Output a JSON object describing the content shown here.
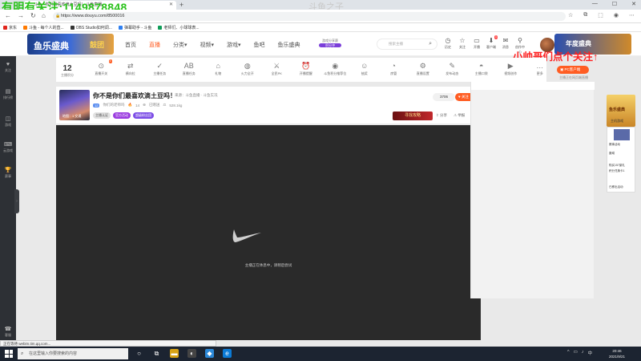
{
  "overlay": {
    "watermark_top": "有明有关注:1149878848",
    "watermark_center": "斗鱼之子",
    "caption_right": "小帅哥们点个关注↑"
  },
  "browser": {
    "tab_title": "斗鱼 - 你们最喜欢滴土豆吗! - 斗鱼直播",
    "new_tab": "+",
    "url": "https://www.douyu.com/8500016",
    "window_buttons": [
      "—",
      "☐",
      "✕"
    ],
    "bookmarks": [
      {
        "label": "京东",
        "color": "#e1251b"
      },
      {
        "label": "斗鱼 - 每个人的直...",
        "color": "#ff7a00"
      },
      {
        "label": "OBS Studio如何调...",
        "color": "#333333"
      },
      {
        "label": "弹幕助手 - 斗鱼",
        "color": "#2e7ff1"
      },
      {
        "label": "老师们、小球球表...",
        "color": "#0f9d58"
      }
    ]
  },
  "site": {
    "logo_text": "鱼乐盛典",
    "logo_badge": "鼓团",
    "nav": [
      "首页",
      "直播",
      "分类",
      "视频",
      "游戏",
      "鱼吧",
      "鱼乐盛典"
    ],
    "promo_line1": "游戏分享赛",
    "promo_line2": "积分冲",
    "search_placeholder": "搜索主播",
    "header_icons": [
      {
        "label": "历史",
        "glyph": "◷",
        "badge": ""
      },
      {
        "label": "关注",
        "glyph": "☆",
        "badge": ""
      },
      {
        "label": "开播",
        "glyph": "▭",
        "badge": ""
      },
      {
        "label": "客户端",
        "glyph": "⬇",
        "badge": "1"
      },
      {
        "label": "消息",
        "glyph": "✉",
        "badge": ""
      },
      {
        "label": "创作中心",
        "glyph": "⚲",
        "badge": ""
      }
    ],
    "header_banner": "年度盛典"
  },
  "sidebar": {
    "items": [
      {
        "label": "关注",
        "glyph": "♥"
      },
      {
        "label": "排行榜",
        "glyph": "▤"
      },
      {
        "label": "游戏",
        "glyph": "◫"
      },
      {
        "label": "云游戏",
        "glyph": "⌨"
      },
      {
        "label": "赛事",
        "glyph": "🏆"
      },
      {
        "label": "客服",
        "glyph": "☎"
      }
    ],
    "collapse": "›"
  },
  "toolbar": {
    "level_num": "12",
    "level_label": "主播积分",
    "items": [
      {
        "label": "直播开关",
        "glyph": "⊙",
        "badge": "3"
      },
      {
        "label": "横向拉",
        "glyph": "⇄",
        "badge": ""
      },
      {
        "label": "主播任务",
        "glyph": "✓",
        "badge": ""
      },
      {
        "label": "直播任务",
        "glyph": "AB",
        "badge": ""
      },
      {
        "label": "礼物",
        "glyph": "⌂",
        "badge": ""
      },
      {
        "label": "火力全开",
        "glyph": "◍",
        "badge": ""
      },
      {
        "label": "全民PK",
        "glyph": "⚔",
        "badge": ""
      },
      {
        "label": "开播提醒",
        "glyph": "⏰",
        "badge": ""
      },
      {
        "label": "斗鱼积分推荐位",
        "glyph": "◉",
        "badge": ""
      },
      {
        "label": "抽奖",
        "glyph": "☺",
        "badge": ""
      },
      {
        "label": "房管",
        "glyph": "◔",
        "badge": ""
      },
      {
        "label": "直播设置",
        "glyph": "⚙",
        "badge": ""
      },
      {
        "label": "发布动态",
        "glyph": "✎",
        "badge": ""
      },
      {
        "label": "主播口袋",
        "glyph": "◓",
        "badge": ""
      },
      {
        "label": "视频创作",
        "glyph": "▶",
        "badge": ""
      },
      {
        "label": "更多",
        "glyph": "…",
        "badge": ""
      }
    ]
  },
  "room": {
    "thumb_label": "地图：1 交通",
    "title": "你不是你们最喜欢滴土豆吗！",
    "meta": "来源：斗鱼直播 · 斗鱼实况",
    "level": "12",
    "streamer": "你们的老师吗",
    "heat": "14",
    "followers": "已赠送",
    "fans": "528.1kg",
    "tags": [
      "主播认证",
      "官方活动",
      "超级粉丝团"
    ],
    "follow_count": "3706",
    "follow_label": "关注",
    "banner": "寻找攻略",
    "share": "分享",
    "report": "举报"
  },
  "player": {
    "message": "主播正在休息中，请稍后尝试"
  },
  "right": {
    "pc_button": "PC客户端",
    "pc_sub": "主播正在网页端直播",
    "ad1": "鱼乐盛典",
    "ad1_label": "主机游戏",
    "ad2_lines": [
      "赛事活动",
      "魔域",
      "购买157豪礼",
      "积分兑换卡1",
      "已移出活动"
    ]
  },
  "status": {
    "url": "正在等待 webim.tim.qq.com..."
  },
  "taskbar": {
    "search_placeholder": "在这里输入你要搜索的内容",
    "apps": [
      {
        "glyph": "○",
        "color": "#1c2431"
      },
      {
        "glyph": "⧉",
        "color": "#1c2431"
      },
      {
        "glyph": "▬",
        "color": "#d8a316"
      },
      {
        "glyph": "◐",
        "color": "#444444"
      },
      {
        "glyph": "◆",
        "color": "#2b88d8"
      },
      {
        "glyph": "e",
        "color": "#0c7bd6"
      }
    ],
    "tray": [
      "^",
      "▭",
      "♪",
      "中"
    ],
    "time": "20:46",
    "date": "2021/9/21"
  }
}
